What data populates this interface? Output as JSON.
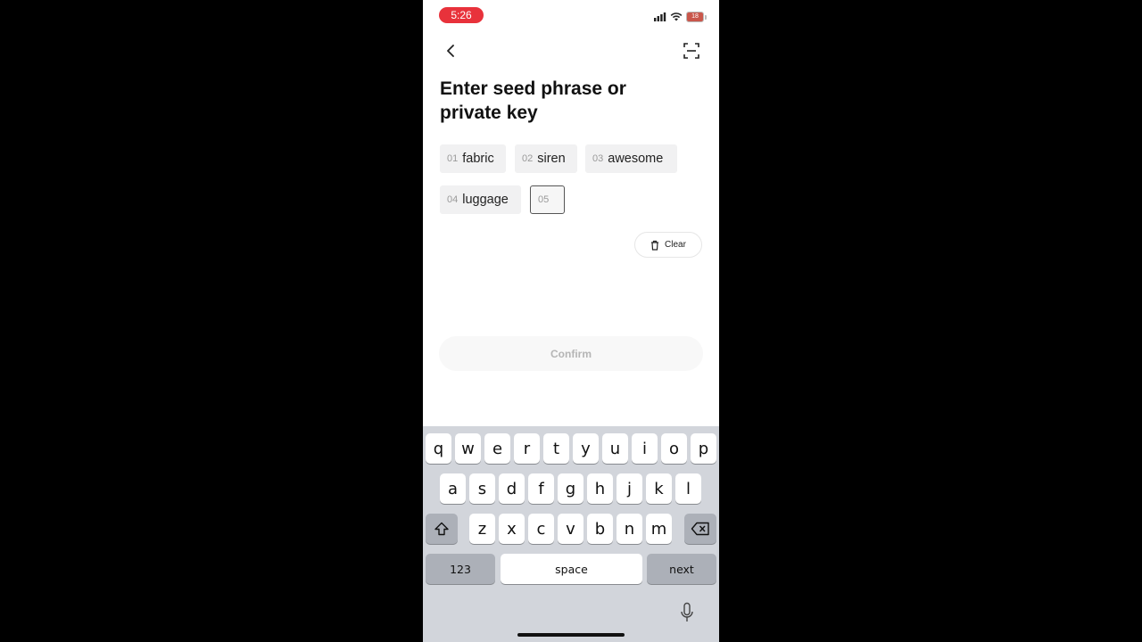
{
  "status_bar": {
    "time": "5:26",
    "battery": "18"
  },
  "header": {
    "title": "Enter seed phrase or private key"
  },
  "words": [
    {
      "num": "01",
      "word": "fabric"
    },
    {
      "num": "02",
      "word": "siren"
    },
    {
      "num": "03",
      "word": "awesome"
    },
    {
      "num": "04",
      "word": "luggage"
    },
    {
      "num": "05",
      "word": ""
    }
  ],
  "actions": {
    "clear_label": "Clear",
    "confirm_label": "Confirm"
  },
  "keyboard": {
    "row1": [
      "q",
      "w",
      "e",
      "r",
      "t",
      "y",
      "u",
      "i",
      "o",
      "p"
    ],
    "row2": [
      "a",
      "s",
      "d",
      "f",
      "g",
      "h",
      "j",
      "k",
      "l"
    ],
    "row3": [
      "z",
      "x",
      "c",
      "v",
      "b",
      "n",
      "m"
    ],
    "numbers_label": "123",
    "space_label": "space",
    "next_label": "next"
  },
  "icons": {
    "back": "chevron-left-icon",
    "scan": "scan-icon",
    "clear": "trash-icon",
    "shift": "shift-icon",
    "delete": "backspace-icon",
    "mic": "microphone-icon"
  }
}
